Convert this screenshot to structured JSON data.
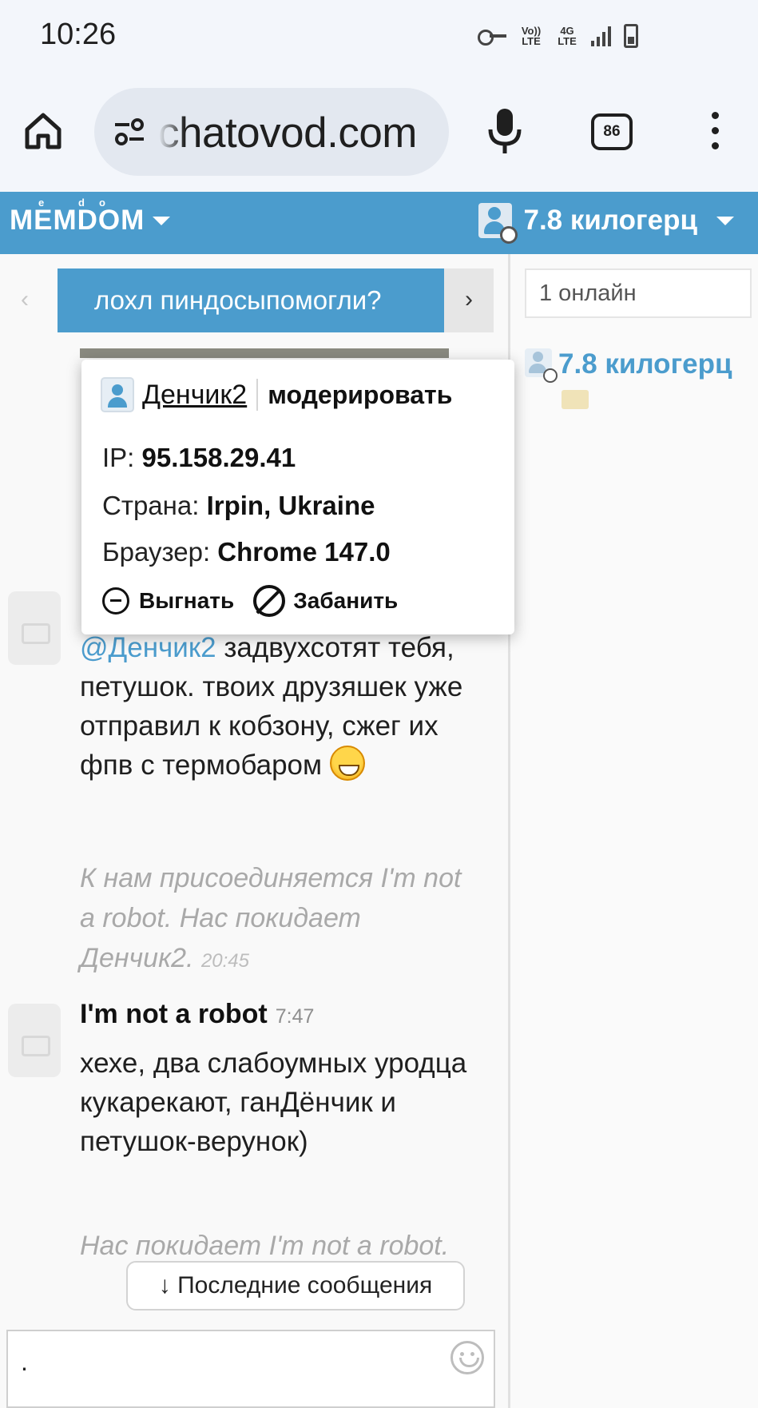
{
  "status_bar": {
    "time": "10:26",
    "volte_label": "Vo)) LTE",
    "network_label": "4G LTE"
  },
  "browser": {
    "url": "chatovod.com",
    "tab_count": "86"
  },
  "site_header": {
    "logo": "MEMDOM",
    "logo_accents": [
      "e",
      "d",
      "o"
    ],
    "user_name": "7.8 килогерц"
  },
  "chat": {
    "topic": "лохл пиндосыпомогли?",
    "prev_arrow": "‹",
    "next_arrow": "›",
    "message1": {
      "mention": "@Денчик2",
      "text": " задвухсотят тебя, петушок. твоих друзяшек уже отправил к кобзону, сжег их фпв с термобаром "
    },
    "system1": {
      "text": "К нам присоединяется I'm not a robot. Нас покидает Денчик2.",
      "time": "20:45"
    },
    "message2": {
      "author": "I'm not a robot",
      "time": "7:47",
      "text": "хехе, два слабоумных уродца кукарекают, ганДёнчик и петушок-верунок)"
    },
    "system2": {
      "text": "Нас покидает I'm not a robot."
    },
    "latest_button": "↓ Последние сообщения",
    "input_value": "."
  },
  "sidebar": {
    "online_count": "1 онлайн",
    "users": [
      {
        "name": "7.8 килогерц"
      }
    ]
  },
  "user_popup": {
    "name": "Денчик2",
    "moderate_label": "модерировать",
    "ip_label": "IP: ",
    "ip_value": "95.158.29.41",
    "country_label": "Страна: ",
    "country_value": "Irpin, Ukraine",
    "browser_label": "Браузер: ",
    "browser_value": "Chrome 147.0",
    "kick_label": "Выгнать",
    "ban_label": "Забанить"
  },
  "colors": {
    "accent": "#4b9ccd",
    "system_text": "#a9a9a9",
    "browser_bg": "#f3f6fb"
  }
}
